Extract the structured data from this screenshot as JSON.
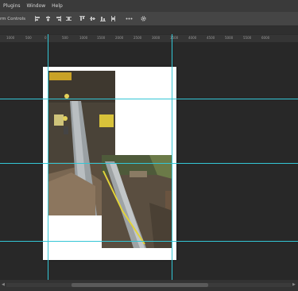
{
  "menu": {
    "items": [
      "Plugins",
      "Window",
      "Help"
    ]
  },
  "options": {
    "transform_label": "rm Controls",
    "align_icons": [
      "align-left-edges-icon",
      "align-horizontal-centers-icon",
      "align-right-edges-icon",
      "distribute-icon",
      "align-top-edges-icon",
      "align-vertical-centers-icon",
      "align-bottom-edges-icon",
      "distribute-vertical-icon"
    ],
    "more_icon": "more-options-icon",
    "settings_icon": "gear-icon"
  },
  "ruler": {
    "ticks": [
      "1000",
      "500",
      "0",
      "500",
      "1000",
      "1500",
      "2000",
      "2500",
      "3000",
      "3500",
      "4000",
      "4500",
      "5000",
      "5500",
      "6000"
    ]
  },
  "colors": {
    "guide": "#33c6d6",
    "background": "#282828",
    "page": "#ffffff"
  }
}
